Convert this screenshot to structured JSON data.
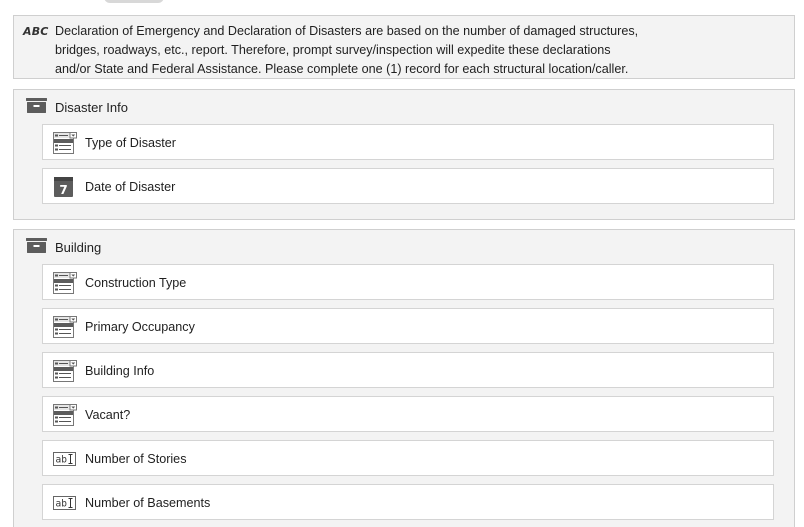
{
  "info_text": {
    "icon": "abc-text-icon",
    "icon_label": "ABC",
    "lines": [
      "Declaration of Emergency and Declaration of Disasters are based on the number of damaged structures,",
      "bridges, roadways, etc., report. Therefore, prompt survey/inspection will expedite these declarations",
      "and/or State and Federal Assistance. Please complete one (1) record for each structural location/caller."
    ]
  },
  "sections": [
    {
      "title": "Disaster Info",
      "icon": "section-box-icon",
      "fields": [
        {
          "label": "Type of Disaster",
          "icon": "dropdown-field-icon"
        },
        {
          "label": "Date of Disaster",
          "icon": "calendar-icon",
          "icon_text": "7"
        }
      ]
    },
    {
      "title": "Building",
      "icon": "section-box-icon",
      "fields": [
        {
          "label": "Construction Type",
          "icon": "dropdown-field-icon"
        },
        {
          "label": "Primary Occupancy",
          "icon": "dropdown-field-icon"
        },
        {
          "label": "Building Info",
          "icon": "dropdown-field-icon"
        },
        {
          "label": "Vacant?",
          "icon": "dropdown-field-icon"
        },
        {
          "label": "Number of Stories",
          "icon": "text-field-icon",
          "icon_text": "ab"
        },
        {
          "label": "Number of Basements",
          "icon": "text-field-icon",
          "icon_text": "ab"
        }
      ]
    }
  ],
  "colors": {
    "panel_bg": "#f3f3f3",
    "panel_border": "#cfcfcf",
    "field_bg": "#ffffff",
    "icon_dark": "#5c5c5c"
  }
}
